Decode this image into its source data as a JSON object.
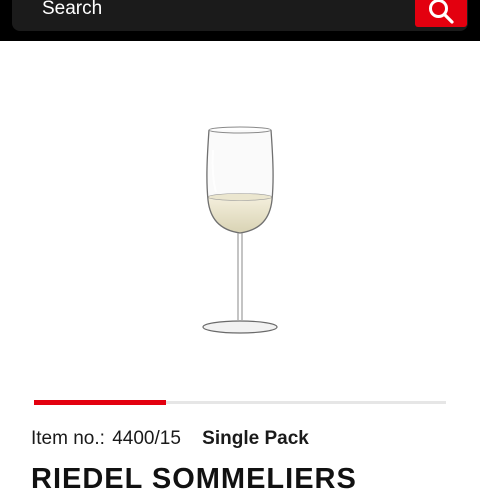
{
  "header": {
    "search_placeholder": "Search",
    "search_icon": "magnifier-icon",
    "accent_color": "#e3000f"
  },
  "product": {
    "image_icon": "wine-glass-image",
    "carousel_progress": 0.32,
    "item_label": "Item no.:",
    "item_number": "4400/15",
    "pack": "Single Pack",
    "title": "RIEDEL SOMMELIERS"
  }
}
